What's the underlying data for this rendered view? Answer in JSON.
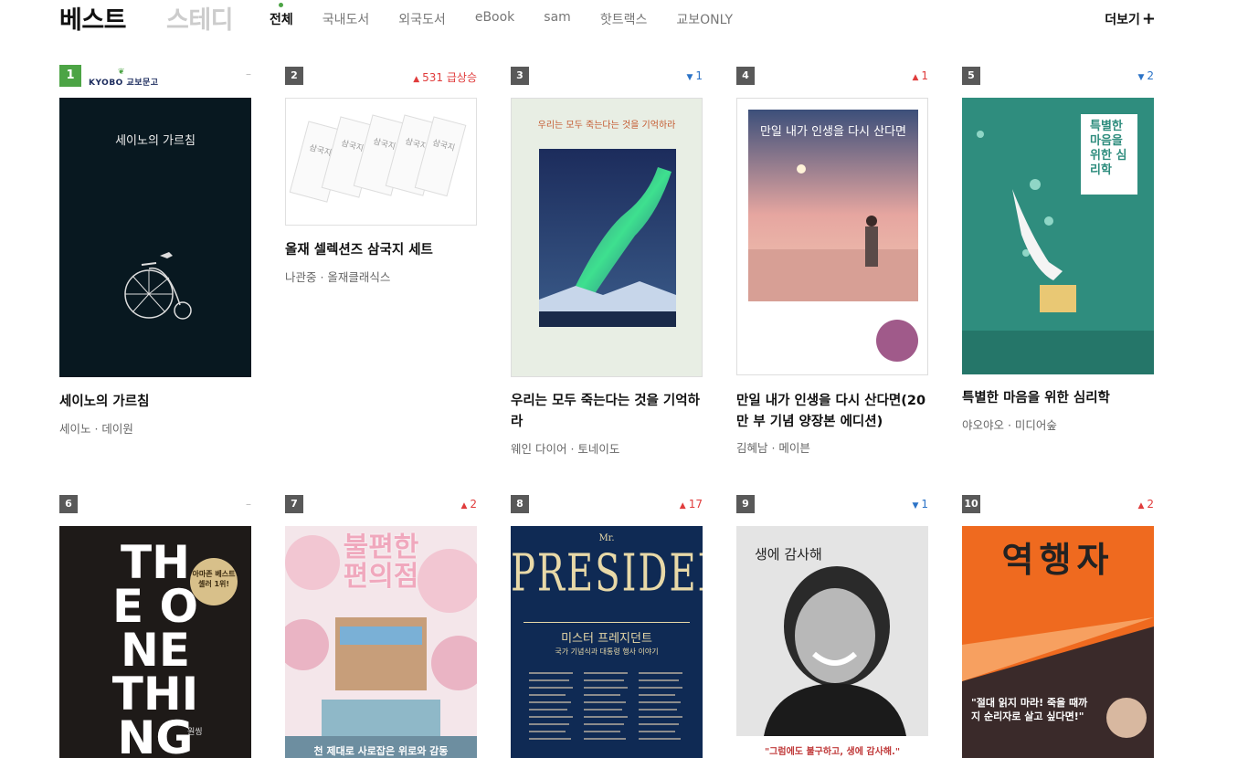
{
  "header": {
    "title": "베스트",
    "title2": "스테디",
    "tabs": [
      "전체",
      "국내도서",
      "외국도서",
      "eBook",
      "sam",
      "핫트랙스",
      "교보ONLY"
    ],
    "active_tab": "전체",
    "more_label": "더보기",
    "more_icon": "plus-icon"
  },
  "kyobo_badge": "KYOBO 교보문고",
  "books": [
    {
      "rank": "1",
      "change": "–",
      "change_dir": "same",
      "title": "세이노의 가르침",
      "author": "세이노 · 데이원",
      "cover_title": "세이노의 가르침"
    },
    {
      "rank": "2",
      "change": "531 급상승",
      "change_dir": "up",
      "title": "올재 셀렉션즈 삼국지 세트",
      "author": "나관중 · 올재클래식스",
      "cover_title": "삼국지"
    },
    {
      "rank": "3",
      "change": "1",
      "change_dir": "down",
      "title": "우리는 모두 죽는다는 것을 기억하라",
      "author": "웨인 다이어 · 토네이도",
      "cover_title": "우리는 모두 죽는다는 것을 기억하라"
    },
    {
      "rank": "4",
      "change": "1",
      "change_dir": "up",
      "title": "만일 내가 인생을 다시 산다면(20만 부 기념 양장본 에디션)",
      "author": "김혜남 · 메이븐",
      "cover_title": "만일 내가 인생을 다시 산다면"
    },
    {
      "rank": "5",
      "change": "2",
      "change_dir": "down",
      "title": "특별한 마음을 위한 심리학",
      "author": "야오야오 · 미디어숲",
      "cover_title": "특별한 마음을 위한 심리학"
    },
    {
      "rank": "6",
      "change": "–",
      "change_dir": "same",
      "cover_title": "THE ONE THING",
      "cover_badge": "아마존 베스트셀러 1위!",
      "cover_sub": "원씽"
    },
    {
      "rank": "7",
      "change": "2",
      "change_dir": "up",
      "cover_title": "불편한 편의점",
      "cover_sub": "천 제대로 사로잡은 위로와 감동"
    },
    {
      "rank": "8",
      "change": "17",
      "change_dir": "up",
      "cover_title": "PRESIDENT",
      "cover_mr": "Mr.",
      "cover_sub": "미스터 프레지던트",
      "cover_sub2": "국가 기념식과 대통령 행사 이야기"
    },
    {
      "rank": "9",
      "change": "1",
      "change_dir": "down",
      "cover_title": "생에 감사해",
      "cover_sub": "\"그럼에도 불구하고, 생에 감사해.\""
    },
    {
      "rank": "10",
      "change": "2",
      "change_dir": "up",
      "cover_title": "역행자",
      "cover_sub": "\"절대 읽지 마라! 죽을 때까지 순리자로 살고 싶다면!\""
    }
  ],
  "colors": {
    "accent": "#4ca445",
    "up": "#e03c3c",
    "down": "#2b73c7"
  }
}
